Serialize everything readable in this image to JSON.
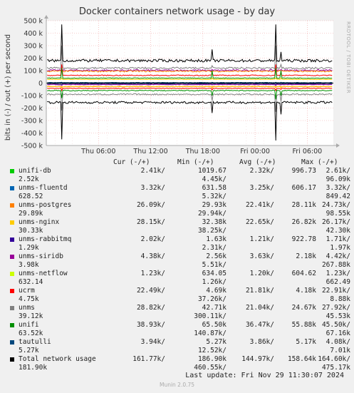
{
  "title": "Docker containers network usage - by day",
  "side_note": "RRDTOOL / TOBI OETIKER",
  "legend_headers": {
    "cur": "Cur (-/+)",
    "min": "Min (-/+)",
    "avg": "Avg (-/+)",
    "max": "Max (-/+)"
  },
  "legend": [
    {
      "name": "unifi-db",
      "color": "#00cc00",
      "cur_out": "2.41k/",
      "cur_in": "2.52k",
      "min_out": "1019.67",
      "min_in": "4.45k/",
      "avg_out": "2.32k/",
      "avg_in": "996.73",
      "max_out": "2.61k/",
      "max_in": "96.09k"
    },
    {
      "name": "unms-fluentd",
      "color": "#0066b3",
      "cur_out": "3.32k/",
      "cur_in": "628.52",
      "min_out": "631.58",
      "min_in": "5.32k/",
      "avg_out": "3.25k/",
      "avg_in": "606.17",
      "max_out": "3.32k/",
      "max_in": "849.42"
    },
    {
      "name": "unms-postgres",
      "color": "#ff8000",
      "cur_out": "26.09k/",
      "cur_in": "29.89k",
      "min_out": "29.93k",
      "min_in": "29.94k/",
      "avg_out": "22.41k/",
      "avg_in": "28.11k",
      "max_out": "24.73k/",
      "max_in": "98.55k"
    },
    {
      "name": "unms-nginx",
      "color": "#ffcc00",
      "cur_out": "28.15k/",
      "cur_in": "30.33k",
      "min_out": "32.38k",
      "min_in": "38.25k/",
      "avg_out": "22.65k/",
      "avg_in": "26.82k",
      "max_out": "26.17k/",
      "max_in": "42.30k"
    },
    {
      "name": "unms-rabbitmq",
      "color": "#330099",
      "cur_out": "2.02k/",
      "cur_in": "1.29k",
      "min_out": "1.63k",
      "min_in": "2.31k/",
      "avg_out": "1.21k/",
      "avg_in": "922.78",
      "max_out": "1.71k/",
      "max_in": "1.97k"
    },
    {
      "name": "unms-siridb",
      "color": "#990099",
      "cur_out": "4.38k/",
      "cur_in": "3.98k",
      "min_out": "2.56k",
      "min_in": "5.51k/",
      "avg_out": "3.63k/",
      "avg_in": "2.18k",
      "max_out": "4.42k/",
      "max_in": "267.88k"
    },
    {
      "name": "unms-netflow",
      "color": "#ccff00",
      "cur_out": "1.23k/",
      "cur_in": "632.14",
      "min_out": "634.05",
      "min_in": "1.26k/",
      "avg_out": "1.20k/",
      "avg_in": "604.62",
      "max_out": "1.23k/",
      "max_in": "662.49"
    },
    {
      "name": "ucrm",
      "color": "#ff0000",
      "cur_out": "22.49k/",
      "cur_in": "4.75k",
      "min_out": "4.69k",
      "min_in": "37.26k/",
      "avg_out": "21.81k/",
      "avg_in": "4.18k",
      "max_out": "22.91k/",
      "max_in": "8.88k"
    },
    {
      "name": "unms",
      "color": "#808080",
      "cur_out": "28.82k/",
      "cur_in": "39.12k",
      "min_out": "42.71k",
      "min_in": "300.11k/",
      "avg_out": "21.04k/",
      "avg_in": "24.67k",
      "max_out": "27.92k/",
      "max_in": "45.53k"
    },
    {
      "name": "unifi",
      "color": "#008f00",
      "cur_out": "38.93k/",
      "cur_in": "63.52k",
      "min_out": "65.50k",
      "min_in": "140.87k/",
      "avg_out": "36.47k/",
      "avg_in": "55.88k",
      "max_out": "45.50k/",
      "max_in": "67.16k"
    },
    {
      "name": "tautulli",
      "color": "#00487d",
      "cur_out": "3.94k/",
      "cur_in": "5.27k",
      "min_out": "5.27k",
      "min_in": "12.52k/",
      "avg_out": "3.86k/",
      "avg_in": "5.17k",
      "max_out": "4.08k/",
      "max_in": "7.01k"
    },
    {
      "name": "Total network usage",
      "color": "#000000",
      "cur_out": "161.77k/",
      "cur_in": "181.90k",
      "min_out": "186.90k",
      "min_in": "460.55k/",
      "avg_out": "144.97k/",
      "avg_in": "158.64k",
      "max_out": "164.60k/",
      "max_in": "475.17k"
    }
  ],
  "footer": "Last update: Fri Nov 29 11:30:07 2024",
  "munin_version": "Munin 2.0.75",
  "chart_data": {
    "type": "line",
    "title": "Docker containers network usage - by day",
    "ylabel": "bits in (-) / out (+) per second",
    "ylim": [
      -500000,
      500000
    ],
    "yticks": [
      {
        "value": 500000,
        "label": "500 k"
      },
      {
        "value": 400000,
        "label": "400 k"
      },
      {
        "value": 300000,
        "label": "300 k"
      },
      {
        "value": 200000,
        "label": "200 k"
      },
      {
        "value": 100000,
        "label": "100 k"
      },
      {
        "value": 0,
        "label": "0"
      },
      {
        "value": -100000,
        "label": "-100 k"
      },
      {
        "value": -200000,
        "label": "-200 k"
      },
      {
        "value": -300000,
        "label": "-300 k"
      },
      {
        "value": -400000,
        "label": "-400 k"
      },
      {
        "value": -500000,
        "label": "-500 k"
      }
    ],
    "xlim_hours": [
      0,
      33
    ],
    "xticks": [
      {
        "hour": 6,
        "label": "Thu 06:00"
      },
      {
        "hour": 12,
        "label": "Thu 12:00"
      },
      {
        "hour": 18,
        "label": "Thu 18:00"
      },
      {
        "hour": 24,
        "label": "Fri 00:00"
      },
      {
        "hour": 30,
        "label": "Fri 06:00"
      }
    ],
    "grid": true,
    "spike_hours": [
      1.8,
      15.2,
      19.1,
      26.4,
      27.0
    ],
    "series": [
      {
        "name": "Total network usage",
        "color": "#000000",
        "out_level": 180000,
        "in_level": -155000,
        "spikes_out": [
          470000,
          0,
          270000,
          470000,
          250000
        ],
        "spikes_in": [
          -450000,
          0,
          -240000,
          -460000,
          -250000
        ]
      },
      {
        "name": "unifi",
        "color": "#008f00",
        "out_level": 40000,
        "in_level": -60000,
        "spikes_out": [
          120000,
          0,
          100000,
          120000,
          100000
        ],
        "spikes_in": [
          -120000,
          0,
          -100000,
          -130000,
          -100000
        ]
      },
      {
        "name": "unms",
        "color": "#808080",
        "out_level": 120000,
        "in_level": -90000,
        "spikes_out": [
          300000,
          0,
          140000,
          300000,
          150000
        ],
        "spikes_in": [
          -220000,
          0,
          -140000,
          -230000,
          -150000
        ]
      },
      {
        "name": "ucrm",
        "color": "#ff0000",
        "out_level": 62000,
        "in_level": -42000,
        "spikes_out": [
          150000,
          0,
          80000,
          150000,
          90000
        ],
        "spikes_in": [
          -60000,
          0,
          -55000,
          -60000,
          -50000
        ]
      },
      {
        "name": "unms-nginx",
        "color": "#ffcc00",
        "out_level": 30000,
        "in_level": -28000,
        "spikes_out": [
          40000,
          0,
          40000,
          40000,
          40000
        ],
        "spikes_in": [
          -38000,
          0,
          -38000,
          -38000,
          -38000
        ]
      },
      {
        "name": "unms-postgres",
        "color": "#ff8000",
        "out_level": 95000,
        "in_level": -27000,
        "spikes_out": [
          98000,
          0,
          98000,
          98000,
          98000
        ],
        "spikes_in": [
          -30000,
          0,
          -30000,
          -30000,
          -30000
        ]
      },
      {
        "name": "unms-siridb",
        "color": "#990099",
        "out_level": 102000,
        "in_level": -12000,
        "spikes_out": [
          120000,
          0,
          110000,
          120000,
          110000
        ],
        "spikes_in": [
          -20000,
          0,
          -15000,
          -20000,
          -15000
        ]
      },
      {
        "name": "tautulli",
        "color": "#00487d",
        "out_level": 4000,
        "in_level": -8000,
        "spikes_out": [
          7000,
          0,
          7000,
          7000,
          7000
        ],
        "spikes_in": [
          -12000,
          0,
          -12000,
          -12000,
          -12000
        ]
      },
      {
        "name": "unms-rabbitmq",
        "color": "#330099",
        "out_level": 2000,
        "in_level": -2000,
        "spikes_out": [
          2000,
          0,
          2000,
          2000,
          2000
        ],
        "spikes_in": [
          -2300,
          0,
          -2300,
          -2300,
          -2300
        ]
      }
    ]
  }
}
